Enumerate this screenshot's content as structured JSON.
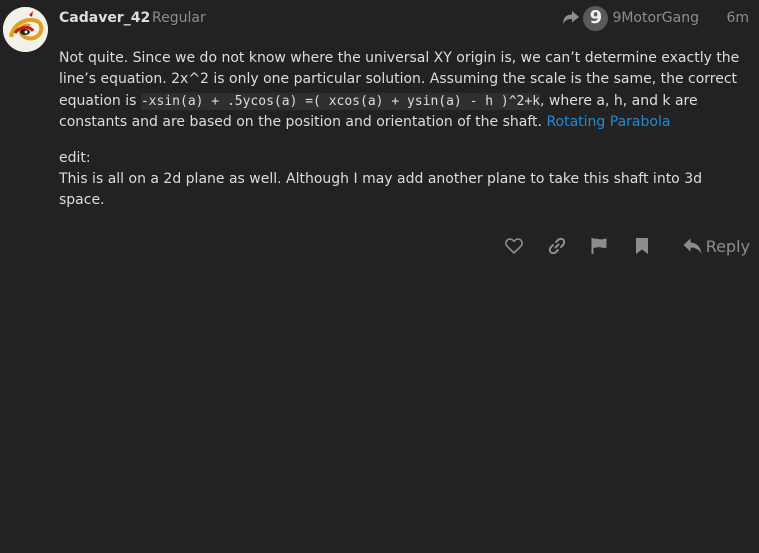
{
  "post": {
    "username": "Cadaver_42",
    "user_title": "Regular",
    "reply_to_name": "9MotorGang",
    "reply_to_avatar_letter": "9",
    "time": "6m",
    "paragraphs": {
      "p1_text1": "Not quite. Since we do not know where the universal XY origin is, we can’t determine exactly the line’s equation. 2x^2 is only one particular solution. Assuming the scale is the same, the correct equation is ",
      "p1_code": "-xsin(a) + .5ycos(a) =( xcos(a) + ysin(a) - h )^2+k",
      "p1_text2": ", where a, h, and k are constants and are based on the position and orientation of the shaft. ",
      "p1_link": "Rotating Parabola",
      "p2_line1": "edit:",
      "p2_line2": "This is all on a 2d plane as well. Although I may add another plane to take this shaft into 3d space."
    }
  },
  "actions": {
    "like_icon": "heart-icon",
    "link_icon": "link-icon",
    "flag_icon": "flag-icon",
    "bookmark_icon": "bookmark-icon",
    "reply_label": "Reply"
  },
  "colors": {
    "background": "#222222",
    "text": "#dddddd",
    "muted": "#8d8d8d",
    "link": "#1e8bd9"
  }
}
